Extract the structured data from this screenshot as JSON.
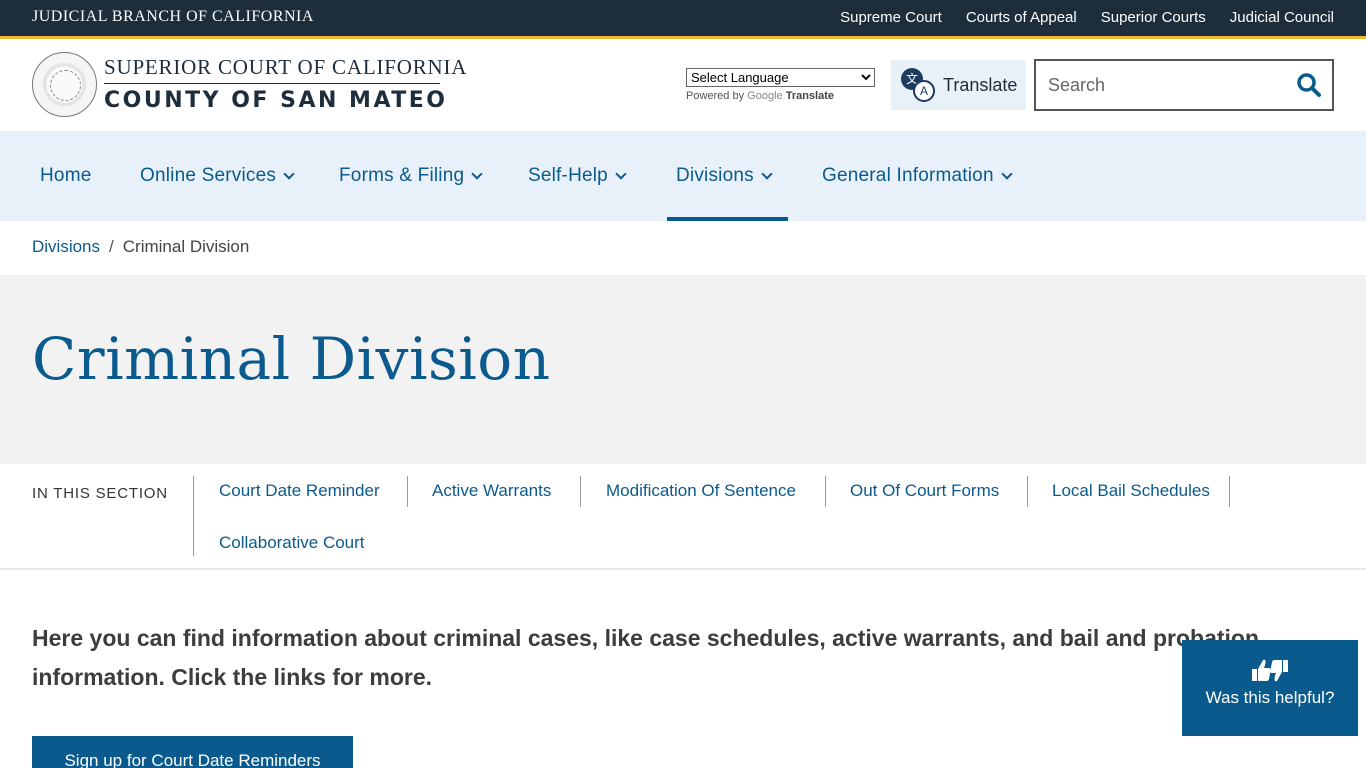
{
  "topbar": {
    "branch": "JUDICIAL BRANCH OF CALIFORNIA",
    "links": [
      "Supreme Court",
      "Courts of Appeal",
      "Superior Courts",
      "Judicial Council"
    ]
  },
  "header": {
    "line1": "SUPERIOR COURT OF CALIFORNIA",
    "line2": "COUNTY OF SAN MATEO",
    "language_select": "Select Language",
    "powered_by": "Powered by",
    "google": "Google",
    "translate_word": "Translate",
    "translate_button": "Translate",
    "search_placeholder": "Search"
  },
  "nav": {
    "items": [
      {
        "label": "Home",
        "has_menu": false
      },
      {
        "label": "Online Services",
        "has_menu": true
      },
      {
        "label": "Forms & Filing",
        "has_menu": true
      },
      {
        "label": "Self-Help",
        "has_menu": true
      },
      {
        "label": "Divisions",
        "has_menu": true,
        "active": true
      },
      {
        "label": "General Information",
        "has_menu": true
      }
    ]
  },
  "breadcrumb": {
    "parent": "Divisions",
    "separator": "/",
    "current": "Criminal Division"
  },
  "page": {
    "title": "Criminal Division",
    "section_label": "IN THIS SECTION",
    "section_links": [
      "Court Date Reminder",
      "Active Warrants",
      "Modification Of Sentence",
      "Out Of Court Forms",
      "Local Bail Schedules",
      "Collaborative Court"
    ],
    "lead": "Here you can find information about criminal cases, like case schedules, active warrants, and bail and probation information. Click the links for more.",
    "cta_button": "Sign up for Court Date Reminders"
  },
  "feedback": {
    "label": "Was this helpful?"
  },
  "colors": {
    "brand_blue": "#0b5a8e",
    "topbar": "#1e2d3b",
    "gold": "#f2b830",
    "nav_bg": "#e8f1f9",
    "hero_bg": "#f2f2f2"
  }
}
